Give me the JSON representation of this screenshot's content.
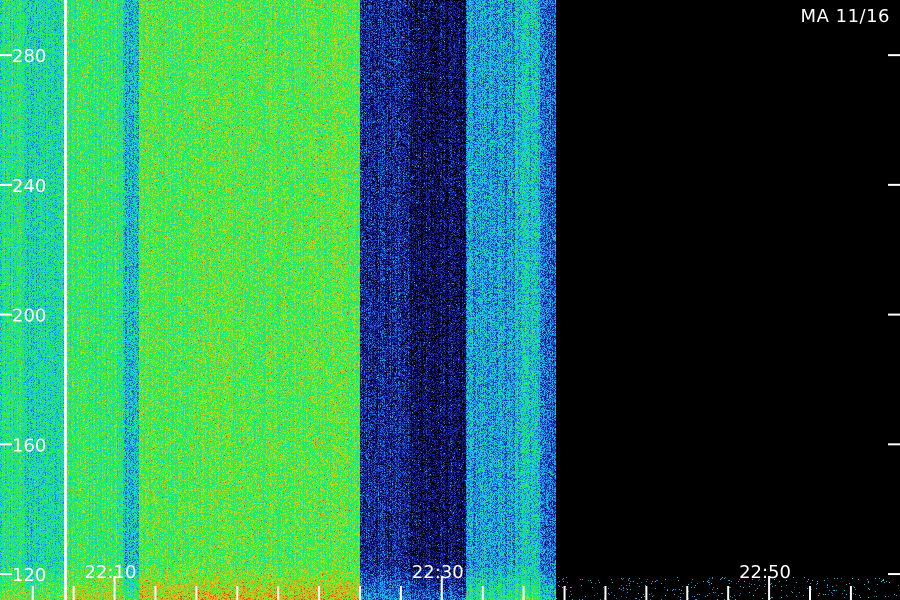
{
  "header": {
    "station_label": "MA 11/16"
  },
  "colors": {
    "background": "#000000",
    "axis": "#ffffff",
    "colormap": [
      "#000000",
      "#0a0a5a",
      "#1a2ab0",
      "#1e78e0",
      "#14c8e6",
      "#20e878",
      "#2cf040",
      "#b4e020",
      "#f0a010",
      "#f04010"
    ]
  },
  "chart_data": {
    "type": "heatmap",
    "title": "",
    "xlabel": "",
    "ylabel": "",
    "x_unit": "time (HH:MM)",
    "xlim": [
      "22:03",
      "22:58"
    ],
    "ylim": [
      112,
      297
    ],
    "x_tick_labels": [
      "22:10",
      "22:30",
      "22:50"
    ],
    "y_tick_labels": [
      "280",
      "240",
      "200",
      "160",
      "120"
    ],
    "y_ticks": [
      280,
      240,
      200,
      160,
      120
    ],
    "x_major_ticks": [
      "22:10",
      "22:30",
      "22:50"
    ],
    "x_minor_ticks": [
      "22:05",
      "22:07.5",
      "22:12.5",
      "22:15",
      "22:17.5",
      "22:20",
      "22:22.5",
      "22:25",
      "22:27.5",
      "22:32.5",
      "22:35",
      "22:37.5",
      "22:40",
      "22:42.5",
      "22:45",
      "22:47.5",
      "22:52.5",
      "22:55"
    ],
    "marker_line_time": "22:07",
    "intensity_scale": "0 = none, 1 = max",
    "segments": [
      {
        "start": "22:03",
        "end": "22:04.5",
        "level": 0.55
      },
      {
        "start": "22:04.5",
        "end": "22:07",
        "level": 0.5
      },
      {
        "start": "22:07",
        "end": "22:10.5",
        "level": 0.6
      },
      {
        "start": "22:10.5",
        "end": "22:11.5",
        "level": 0.42
      },
      {
        "start": "22:11.5",
        "end": "22:25",
        "level": 0.66
      },
      {
        "start": "22:25",
        "end": "22:28",
        "level": 0.18
      },
      {
        "start": "22:28",
        "end": "22:31.5",
        "level": 0.1
      },
      {
        "start": "22:31.5",
        "end": "22:34.5",
        "level": 0.38
      },
      {
        "start": "22:34.5",
        "end": "22:36",
        "level": 0.44
      },
      {
        "start": "22:36",
        "end": "22:37",
        "level": 0.28
      },
      {
        "start": "22:37",
        "end": "22:58",
        "level": 0.0
      }
    ]
  }
}
